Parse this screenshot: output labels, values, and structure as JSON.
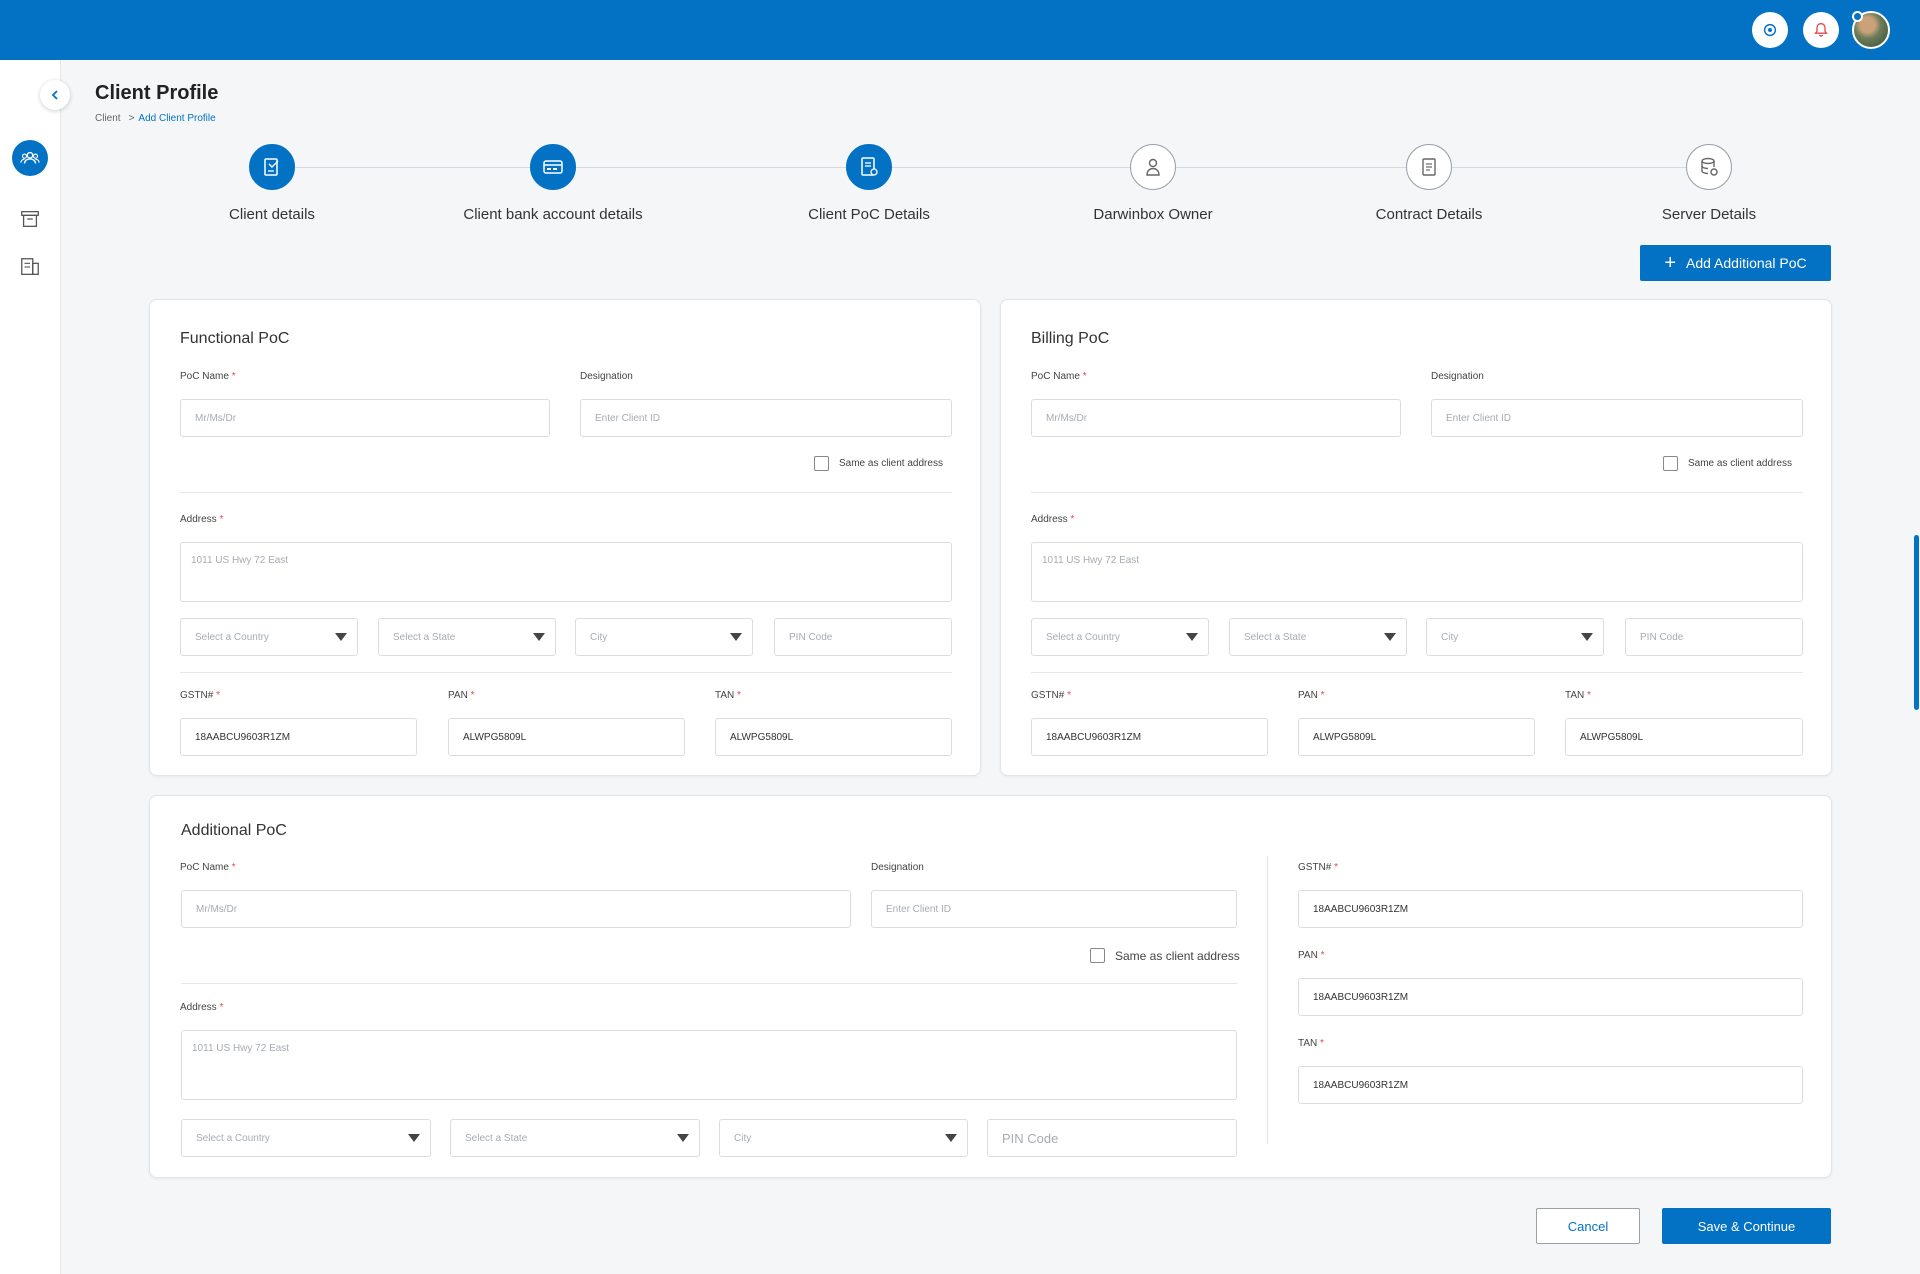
{
  "page": {
    "title": "Client Profile",
    "breadcrumb": {
      "root": "Client",
      "separator": ">",
      "current": "Add Client Profile"
    }
  },
  "colors": {
    "primary": "#0372c4",
    "required": "#e5484d"
  },
  "topbar": {
    "icons": [
      "settings-icon",
      "notification-icon"
    ],
    "avatar": "user-avatar"
  },
  "sidebar": {
    "items": [
      "clients-icon",
      "archive-icon",
      "documents-icon"
    ],
    "active": "clients-icon"
  },
  "stepper": {
    "steps": [
      {
        "label": "Client details",
        "icon": "edit-document-icon",
        "state": "done"
      },
      {
        "label": "Client bank account details",
        "icon": "bank-card-icon",
        "state": "done"
      },
      {
        "label": "Client PoC Details",
        "icon": "poc-document-icon",
        "state": "active"
      },
      {
        "label": "Darwinbox Owner",
        "icon": "owner-icon",
        "state": "pending"
      },
      {
        "label": "Contract Details",
        "icon": "contract-icon",
        "state": "pending"
      },
      {
        "label": "Server Details",
        "icon": "server-icon",
        "state": "pending"
      }
    ]
  },
  "actions": {
    "add_poc": "Add Additional PoC",
    "cancel": "Cancel",
    "save": "Save & Continue"
  },
  "functional": {
    "title": "Functional PoC",
    "poc_name_label": "PoC Name",
    "poc_name_placeholder": "Mr/Ms/Dr",
    "designation_label": "Designation",
    "designation_placeholder": "Enter Client ID",
    "same_address": "Same as client address",
    "address_label": "Address",
    "address_placeholder": "1011 US Hwy 72 East",
    "country": "Select a Country",
    "state": "Select a State",
    "city": "City",
    "pin": "PIN Code",
    "gstn_label": "GSTN#",
    "gstn_value": "18AABCU9603R1ZM",
    "pan_label": "PAN",
    "pan_value": "ALWPG5809L",
    "tan_label": "TAN",
    "tan_value": "ALWPG5809L"
  },
  "billing": {
    "title": "Billing PoC",
    "poc_name_label": "PoC Name",
    "poc_name_placeholder": "Mr/Ms/Dr",
    "designation_label": "Designation",
    "designation_placeholder": "Enter Client ID",
    "same_address": "Same as client address",
    "address_label": "Address",
    "address_placeholder": "1011 US Hwy 72 East",
    "country": "Select a Country",
    "state": "Select a State",
    "city": "City",
    "pin": "PIN Code",
    "gstn_label": "GSTN#",
    "gstn_value": "18AABCU9603R1ZM",
    "pan_label": "PAN",
    "pan_value": "ALWPG5809L",
    "tan_label": "TAN",
    "tan_value": "ALWPG5809L"
  },
  "additional": {
    "title": "Additional PoC",
    "poc_name_label": "PoC Name",
    "poc_name_placeholder": "Mr/Ms/Dr",
    "designation_label": "Designation",
    "designation_placeholder": "Enter Client ID",
    "same_address": "Same as client address",
    "address_label": "Address",
    "address_placeholder": "1011 US Hwy 72 East",
    "country": "Select a Country",
    "state": "Select a State",
    "city": "City",
    "pin": "PIN Code",
    "gstn_label": "GSTN#",
    "gstn_value": "18AABCU9603R1ZM",
    "pan_label": "PAN",
    "pan_value": "18AABCU9603R1ZM",
    "tan_label": "TAN",
    "tan_value": "18AABCU9603R1ZM"
  }
}
